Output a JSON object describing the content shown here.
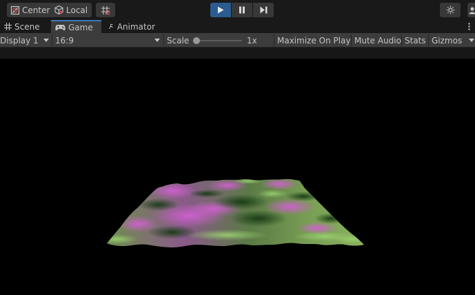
{
  "toolbar": {
    "center_label": "Center",
    "local_label": "Local",
    "pivot_icon": "pivot-center-icon",
    "local_icon": "local-cube-icon",
    "grid_snap_icon": "grid-snap-icon",
    "play_icon": "play-icon",
    "pause_icon": "pause-icon",
    "step_icon": "step-icon",
    "lighting_icon": "lighting-sun-icon",
    "play_active_color": "#2a5c8f"
  },
  "tabs": [
    {
      "label": "Scene",
      "icon": "grid-icon"
    },
    {
      "label": "Game",
      "icon": "gamepad-icon"
    },
    {
      "label": "Animator",
      "icon": "animator-icon"
    }
  ],
  "game_toolbar": {
    "display": "Display 1",
    "aspect": "16:9",
    "scale_label": "Scale",
    "scale_value": "1x",
    "scale_slider": 0,
    "maximize_on_play": "Maximize On Play",
    "mute_audio": "Mute Audio",
    "stats": "Stats",
    "gizmos": "Gizmos"
  },
  "viewport": {
    "background": "#000000",
    "surface_colors": {
      "high": "#c050c0",
      "mid": "#7a9a55",
      "low": "#2a5a28"
    }
  }
}
